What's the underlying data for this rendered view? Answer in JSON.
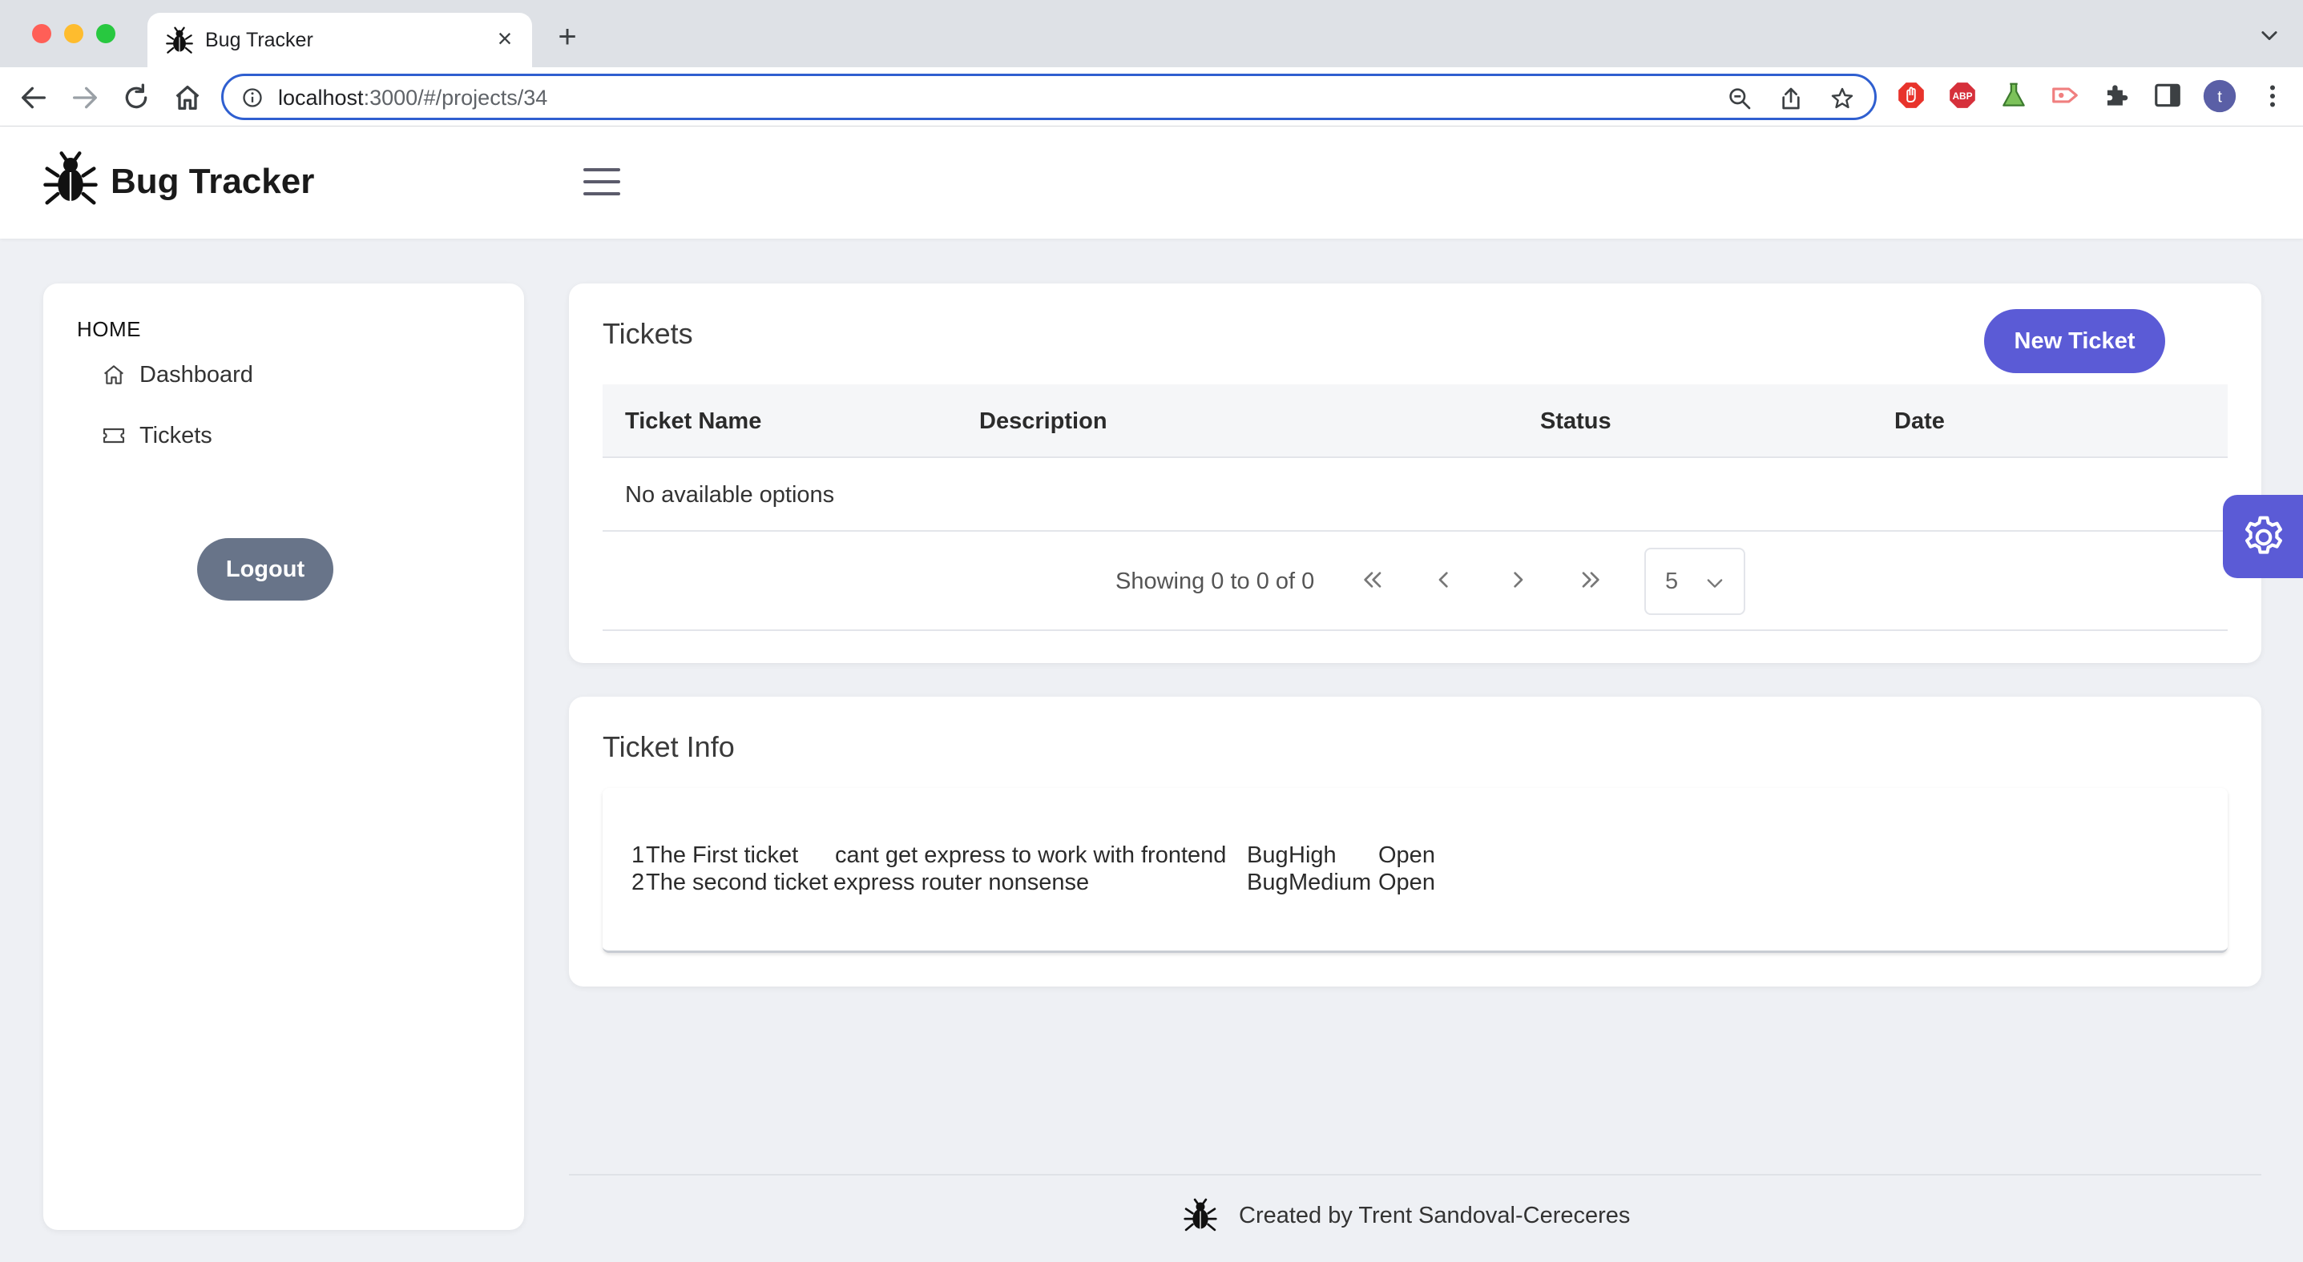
{
  "browser": {
    "tab_title": "Bug Tracker",
    "tab_close_glyph": "×",
    "new_tab_glyph": "+",
    "url_host": "localhost",
    "url_path": ":3000/#/projects/34",
    "profile_initial": "t",
    "extensions": [
      "adblock-icon",
      "abp-icon",
      "flask-icon",
      "cast-icon",
      "puzzle-icon",
      "sidepanel-icon"
    ],
    "accent_color": "#2f5fd0"
  },
  "header": {
    "app_title": "Bug Tracker"
  },
  "sidebar": {
    "heading": "HOME",
    "items": [
      {
        "label": "Dashboard",
        "icon": "home-icon"
      },
      {
        "label": "Tickets",
        "icon": "ticket-icon"
      }
    ],
    "logout_label": "Logout"
  },
  "tickets": {
    "title": "Tickets",
    "new_ticket_label": "New Ticket",
    "columns": [
      "Ticket Name",
      "Description",
      "Status",
      "Date"
    ],
    "empty_message": "No available options",
    "pagination": {
      "summary": "Showing 0 to 0 of 0",
      "page_size": "5"
    }
  },
  "ticket_info": {
    "title": "Ticket Info",
    "rows": [
      {
        "id": "1",
        "name": "The First ticket",
        "description": "cant get express to work with frontend",
        "type": "Bug",
        "priority": "High",
        "status": "Open"
      },
      {
        "id": "2",
        "name": "The second ticket",
        "description": "express router nonsense",
        "type": "Bug",
        "priority": "Medium",
        "status": "Open"
      }
    ]
  },
  "footer": {
    "text": "Created by Trent Sandoval-Cereceres"
  },
  "colors": {
    "primary": "#5b5bd6",
    "logout": "#687489",
    "background": "#eef0f4"
  }
}
